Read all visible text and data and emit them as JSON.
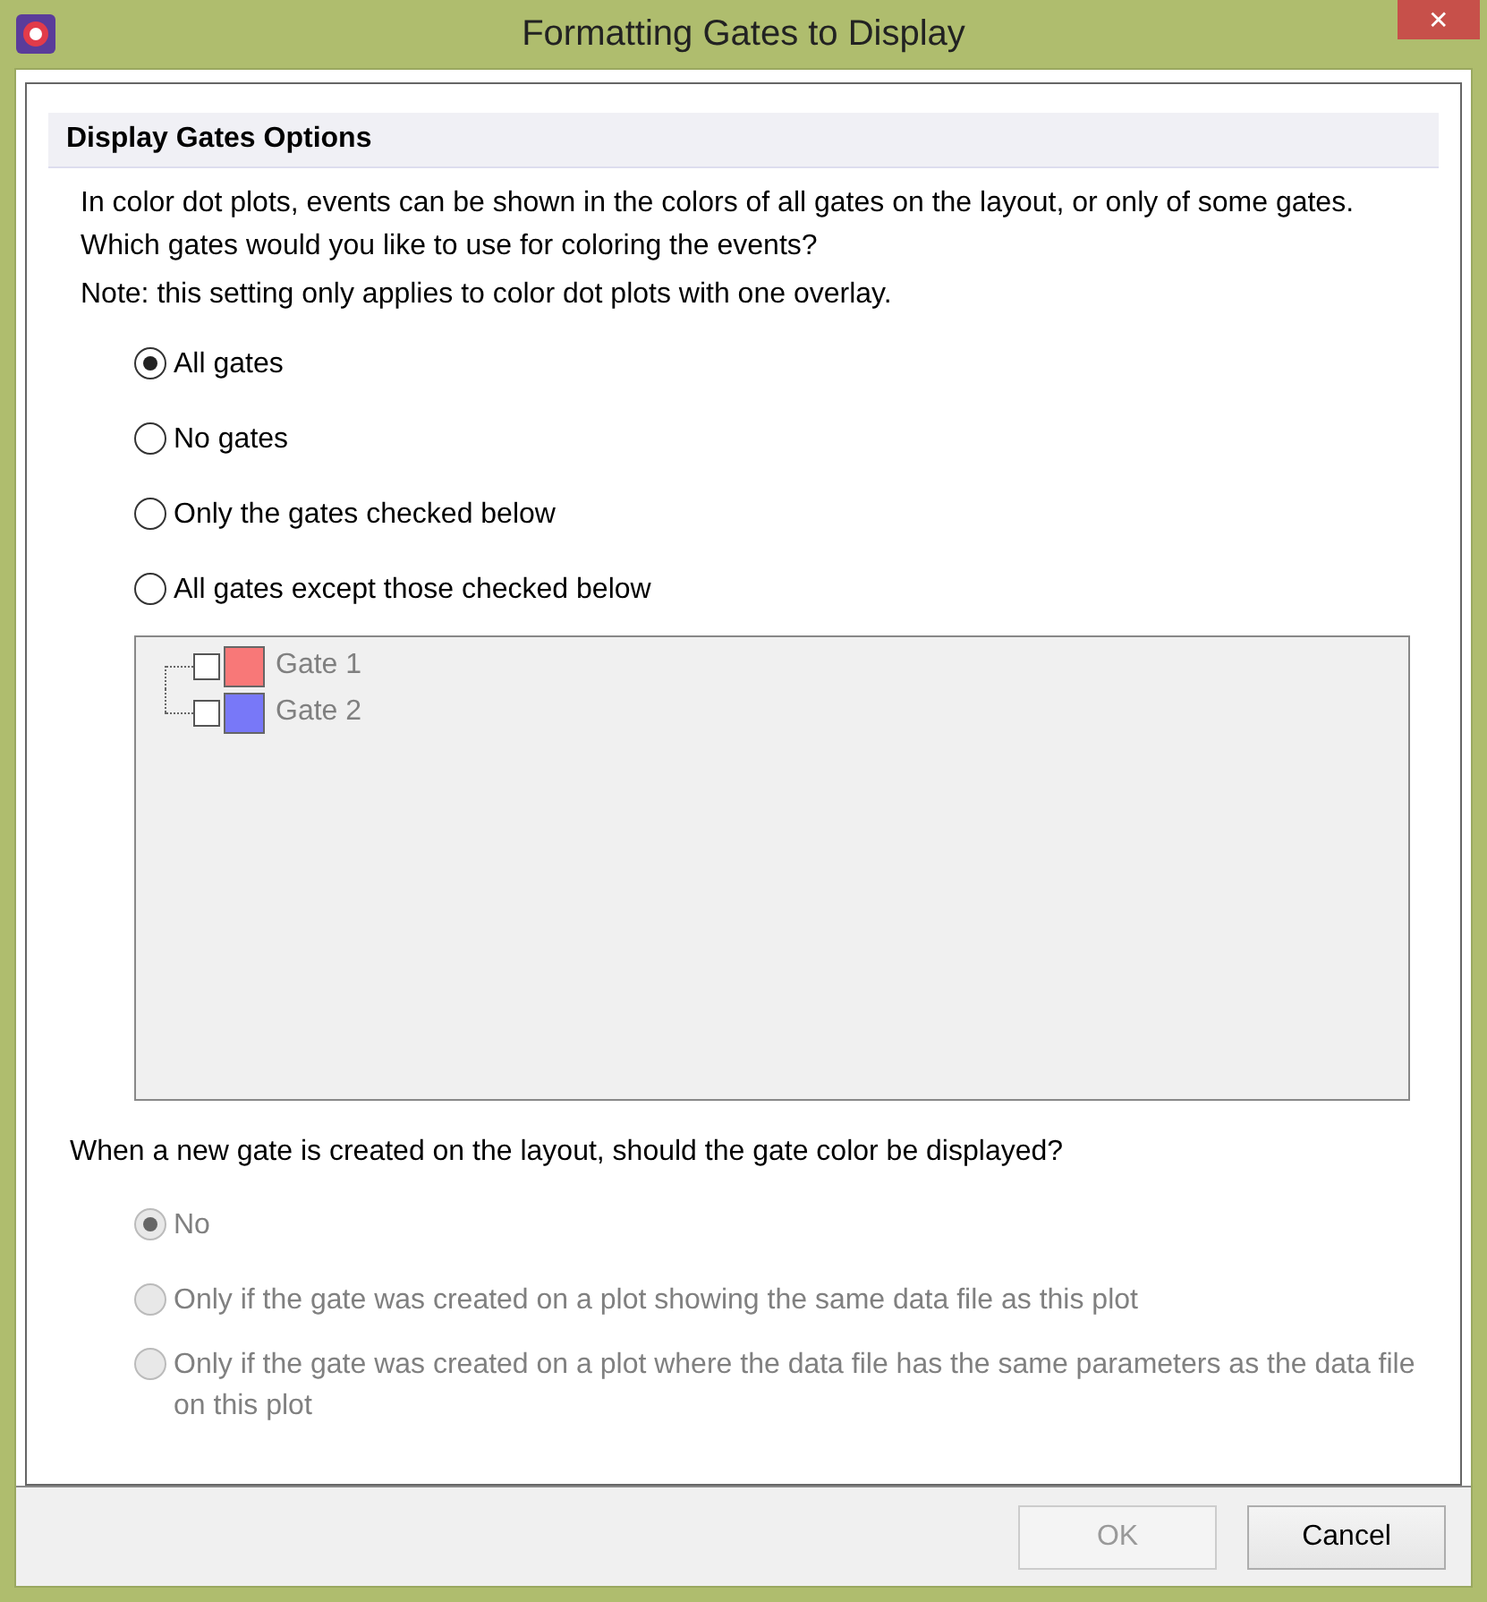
{
  "window": {
    "title": "Formatting Gates to Display",
    "close": "✕"
  },
  "section": {
    "title": "Display Gates Options"
  },
  "intro": "In color dot plots, events can be shown in the colors of all gates on the layout, or only of some gates. Which gates would you like to use for coloring the events?",
  "note": "Note: this setting only applies to color dot plots with one overlay.",
  "gate_options": [
    {
      "label": "All gates",
      "selected": true,
      "disabled": false
    },
    {
      "label": "No gates",
      "selected": false,
      "disabled": false
    },
    {
      "label": "Only the gates checked below",
      "selected": false,
      "disabled": false
    },
    {
      "label": "All gates except those checked below",
      "selected": false,
      "disabled": false
    }
  ],
  "gates": {
    "disabled": true,
    "items": [
      {
        "label": "Gate 1",
        "checked": false,
        "color": "#f87878"
      },
      {
        "label": "Gate 2",
        "checked": false,
        "color": "#7878f8"
      }
    ]
  },
  "question": "When a new gate is created on the layout, should the gate color be displayed?",
  "new_gate_options": [
    {
      "label": "No",
      "selected": true,
      "disabled": true
    },
    {
      "label": "Only if the gate was created on a plot showing the same data file as this plot",
      "selected": false,
      "disabled": true
    },
    {
      "label": "Only if the gate was created on a plot where the data file has the same parameters as the data file on this plot",
      "selected": false,
      "disabled": true
    }
  ],
  "buttons": [
    {
      "label": "OK",
      "disabled": true
    },
    {
      "label": "Cancel",
      "disabled": false
    }
  ]
}
